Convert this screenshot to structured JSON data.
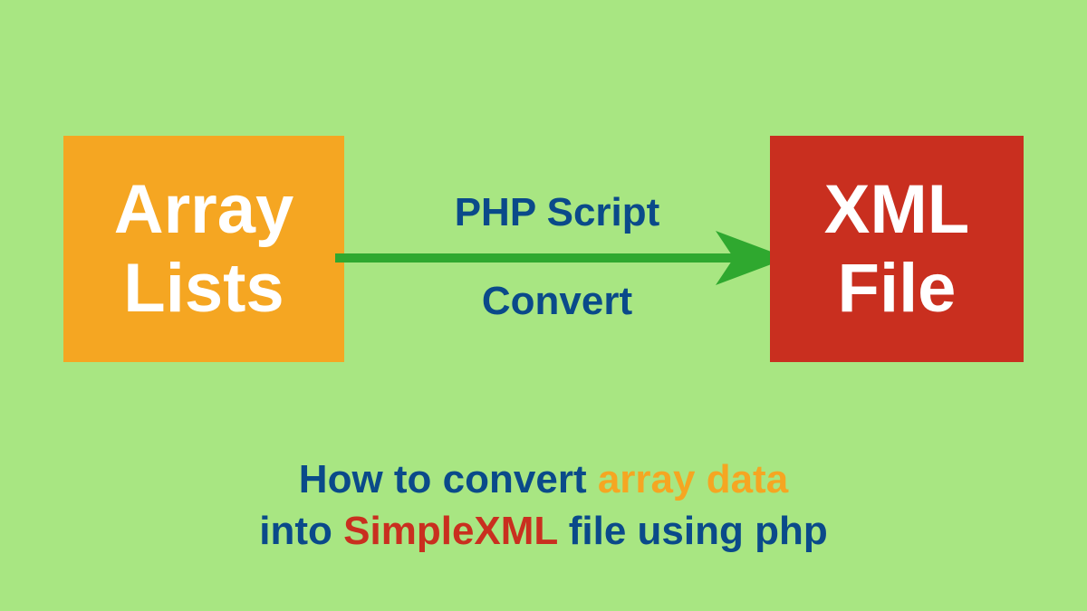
{
  "left_box": {
    "line1": "Array",
    "line2": "Lists"
  },
  "right_box": {
    "line1": "XML",
    "line2": "File"
  },
  "arrow": {
    "top_label": "PHP Script",
    "bottom_label": "Convert"
  },
  "caption": {
    "part1": "How to convert ",
    "part2": "array data",
    "part3": "into ",
    "part4": "SimpleXML",
    "part5": " file using php"
  },
  "colors": {
    "background": "#a8e682",
    "orange": "#f5a622",
    "red": "#c92f1f",
    "blue": "#0a4a8a",
    "green": "#2fa82f"
  }
}
